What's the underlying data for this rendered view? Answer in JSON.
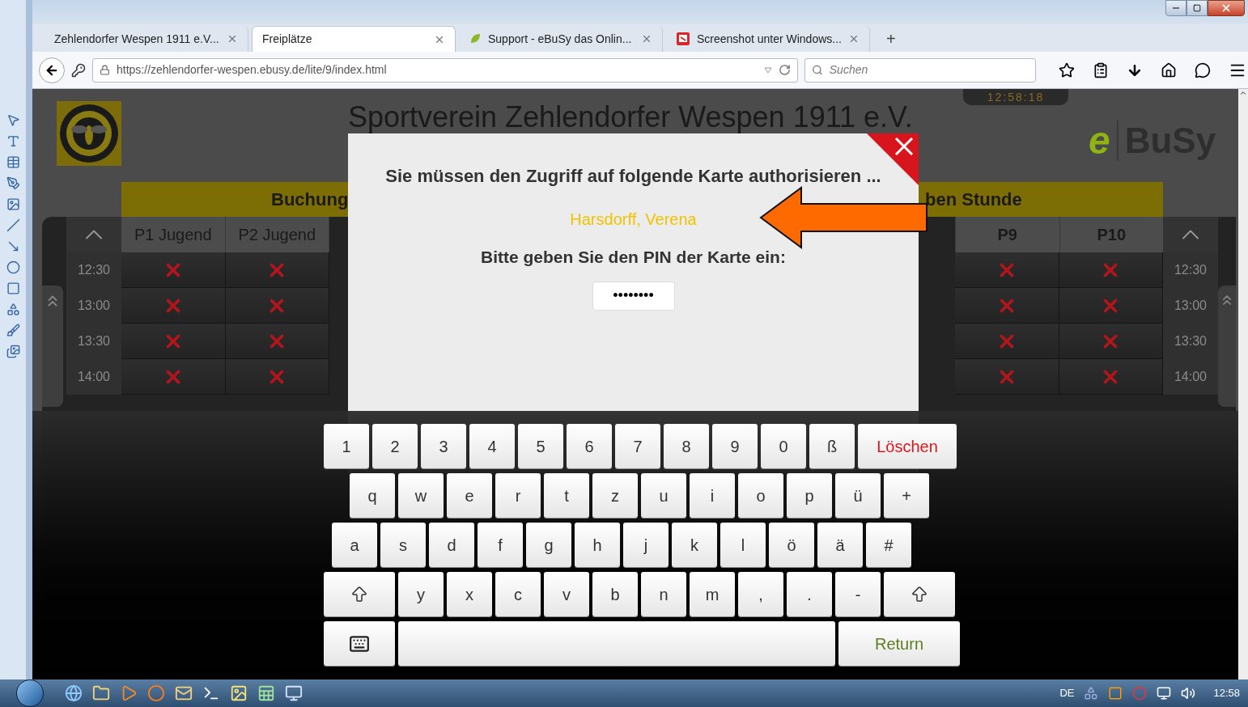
{
  "browser": {
    "tabs": [
      {
        "title": "Zehlendorfer Wespen 1911 e.V...",
        "selected": false,
        "kind": "plain"
      },
      {
        "title": "Freiplätze",
        "selected": true,
        "kind": "plain"
      },
      {
        "title": "Support - eBuSy das Onlin...",
        "selected": false,
        "kind": "leaf"
      },
      {
        "title": "Screenshot unter Windows...",
        "selected": false,
        "kind": "snip"
      }
    ],
    "new_tab": "+",
    "url": "https://zehlendorfer-wespen.ebusy.de/lite/9/index.html",
    "search": {
      "placeholder": "Suchen"
    }
  },
  "page": {
    "title": "Sportverein Zehlendorfer Wespen 1911 e.V.",
    "clock": "12:58:18",
    "brand": {
      "mark": "e",
      "name": "BuSy"
    },
    "band_left": "Buchung",
    "band_right": "ben Stunde",
    "columns_left": [
      "P1 Jugend",
      "P2 Jugend"
    ],
    "columns_right": [
      "P9",
      "P10"
    ],
    "rows": [
      {
        "time_left": "12:30",
        "time_right": "12:30",
        "left": [
          {
            "booked": true
          },
          {
            "booked": true
          }
        ],
        "right": [
          {
            "booked": true
          },
          {
            "booked": true
          }
        ]
      },
      {
        "time_left": "13:00",
        "time_right": "13:00",
        "left": [
          {
            "booked": true
          },
          {
            "booked": true
          }
        ],
        "right": [
          {
            "booked": true
          },
          {
            "booked": true
          }
        ]
      },
      {
        "time_left": "13:30",
        "time_right": "13:30",
        "left": [
          {
            "booked": true
          },
          {
            "booked": true
          }
        ],
        "right": [
          {
            "booked": true
          },
          {
            "booked": true
          }
        ]
      },
      {
        "time_left": "14:00",
        "time_right": "14:00",
        "left": [
          {
            "booked": true
          },
          {
            "booked": true
          }
        ],
        "right": [
          {
            "booked": true
          },
          {
            "booked": true
          }
        ]
      }
    ]
  },
  "dialog": {
    "title": "Sie müssen den Zugriff auf folgende Karte authorisieren ...",
    "card_holder": "Harsdorff, Verena",
    "prompt": "Bitte geben Sie den PIN der Karte ein:",
    "pin": "••••••••"
  },
  "keyboard": {
    "rows": [
      [
        {
          "kind": "char",
          "label": "1"
        },
        {
          "kind": "char",
          "label": "2"
        },
        {
          "kind": "char",
          "label": "3"
        },
        {
          "kind": "char",
          "label": "4"
        },
        {
          "kind": "char",
          "label": "5"
        },
        {
          "kind": "char",
          "label": "6"
        },
        {
          "kind": "char",
          "label": "7"
        },
        {
          "kind": "char",
          "label": "8"
        },
        {
          "kind": "char",
          "label": "9"
        },
        {
          "kind": "char",
          "label": "0"
        },
        {
          "kind": "char",
          "label": "ß"
        },
        {
          "kind": "delete",
          "label": "Löschen"
        }
      ],
      [
        {
          "kind": "char",
          "label": "q"
        },
        {
          "kind": "char",
          "label": "w"
        },
        {
          "kind": "char",
          "label": "e"
        },
        {
          "kind": "char",
          "label": "r"
        },
        {
          "kind": "char",
          "label": "t"
        },
        {
          "kind": "char",
          "label": "z"
        },
        {
          "kind": "char",
          "label": "u"
        },
        {
          "kind": "char",
          "label": "i"
        },
        {
          "kind": "char",
          "label": "o"
        },
        {
          "kind": "char",
          "label": "p"
        },
        {
          "kind": "char",
          "label": "ü"
        },
        {
          "kind": "char",
          "label": "+"
        }
      ],
      [
        {
          "kind": "char",
          "label": "a"
        },
        {
          "kind": "char",
          "label": "s"
        },
        {
          "kind": "char",
          "label": "d"
        },
        {
          "kind": "char",
          "label": "f"
        },
        {
          "kind": "char",
          "label": "g"
        },
        {
          "kind": "char",
          "label": "h"
        },
        {
          "kind": "char",
          "label": "j"
        },
        {
          "kind": "char",
          "label": "k"
        },
        {
          "kind": "char",
          "label": "l"
        },
        {
          "kind": "char",
          "label": "ö"
        },
        {
          "kind": "char",
          "label": "ä"
        },
        {
          "kind": "char",
          "label": "#"
        }
      ],
      [
        {
          "kind": "shift"
        },
        {
          "kind": "char",
          "label": "y"
        },
        {
          "kind": "char",
          "label": "x"
        },
        {
          "kind": "char",
          "label": "c"
        },
        {
          "kind": "char",
          "label": "v"
        },
        {
          "kind": "char",
          "label": "b"
        },
        {
          "kind": "char",
          "label": "n"
        },
        {
          "kind": "char",
          "label": "m"
        },
        {
          "kind": "char",
          "label": ","
        },
        {
          "kind": "char",
          "label": "."
        },
        {
          "kind": "char",
          "label": "-"
        },
        {
          "kind": "shift"
        }
      ]
    ],
    "bottom_keys": [
      {
        "kind": "hide"
      },
      {
        "kind": "space"
      },
      {
        "kind": "return",
        "label": "Return"
      }
    ]
  },
  "taskbar": {
    "language": "DE",
    "time": "12:58"
  }
}
